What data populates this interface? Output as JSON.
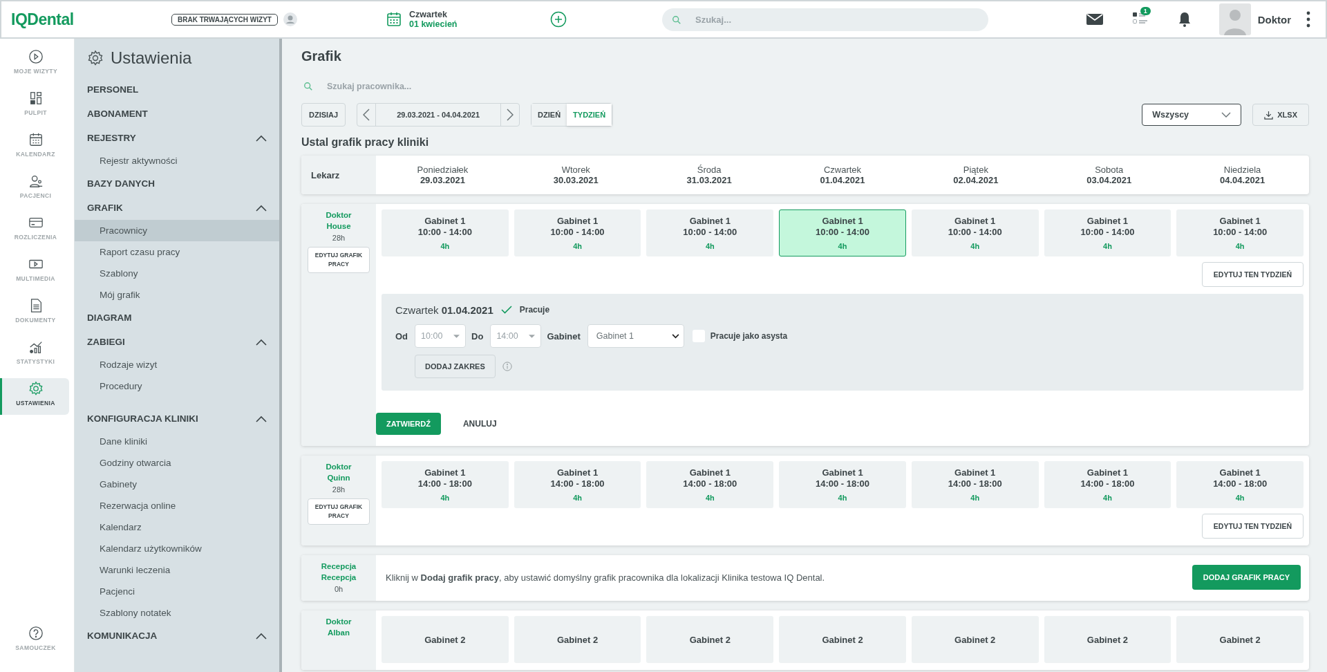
{
  "topbar": {
    "logo": "IQDental",
    "visit_status": "BRAK TRWAJĄCYCH WIZYT",
    "weekday": "Czwartek",
    "date": "01 kwiecień",
    "search": {
      "placeholder": "Szukaj..."
    },
    "tasks_badge": "1",
    "user": "Doktor"
  },
  "nav": {
    "items": [
      {
        "label": "MOJE WIZYTY",
        "selected": false
      },
      {
        "label": "PULPIT",
        "selected": false
      },
      {
        "label": "KALENDARZ",
        "selected": false
      },
      {
        "label": "PACJENCI",
        "selected": false
      },
      {
        "label": "ROZLICZENIA",
        "selected": false
      },
      {
        "label": "MULTIMEDIA",
        "selected": false
      },
      {
        "label": "DOKUMENTY",
        "selected": false
      },
      {
        "label": "STATYSTYKI",
        "selected": false
      },
      {
        "label": "USTAWIENIA",
        "selected": true
      }
    ],
    "help": "SAMOUCZEK"
  },
  "settings": {
    "title": "Ustawienia",
    "sections": [
      {
        "label": "PERSONEL"
      },
      {
        "label": "ABONAMENT"
      },
      {
        "label": "REJESTRY",
        "expanded": true,
        "children": [
          {
            "label": "Rejestr aktywności",
            "selected": false
          }
        ]
      },
      {
        "label": "BAZY DANYCH"
      },
      {
        "label": "GRAFIK",
        "expanded": true,
        "children": [
          {
            "label": "Pracownicy",
            "selected": true
          },
          {
            "label": "Raport czasu pracy",
            "selected": false
          },
          {
            "label": "Szablony",
            "selected": false
          },
          {
            "label": "Mój grafik",
            "selected": false
          }
        ]
      },
      {
        "label": "DIAGRAM"
      },
      {
        "label": "ZABIEGI",
        "expanded": true,
        "children": [
          {
            "label": "Rodzaje wizyt",
            "selected": false
          },
          {
            "label": "Procedury",
            "selected": false
          }
        ]
      },
      {
        "label": "KONFIGURACJA KLINIKI",
        "expanded": true,
        "children": [
          {
            "label": "Dane kliniki",
            "selected": false
          },
          {
            "label": "Godziny otwarcia",
            "selected": false
          },
          {
            "label": "Gabinety",
            "selected": false
          },
          {
            "label": "Rezerwacja online",
            "selected": false
          },
          {
            "label": "Kalendarz",
            "selected": false
          },
          {
            "label": "Kalendarz użytkowników",
            "selected": false
          },
          {
            "label": "Warunki leczenia",
            "selected": false
          },
          {
            "label": "Pacjenci",
            "selected": false
          },
          {
            "label": "Szablony notatek",
            "selected": false
          }
        ]
      },
      {
        "label": "KOMUNIKACJA",
        "expanded": true
      }
    ]
  },
  "page": {
    "title": "Grafik",
    "employee_search": {
      "placeholder": "Szukaj pracownika..."
    },
    "today_button": "DZISIAJ",
    "range": "29.03.2021 - 04.04.2021",
    "view_tabs": [
      {
        "label": "DZIEŃ",
        "selected": false
      },
      {
        "label": "TYDZIEŃ",
        "selected": true
      }
    ],
    "filter": "Wszyscy",
    "export_button": "XLSX",
    "section_title": "Ustal grafik pracy kliniki"
  },
  "header": {
    "label": "Lekarz",
    "days": [
      {
        "weekday": "Poniedziałek",
        "date": "29.03.2021"
      },
      {
        "weekday": "Wtorek",
        "date": "30.03.2021"
      },
      {
        "weekday": "Środa",
        "date": "31.03.2021"
      },
      {
        "weekday": "Czwartek",
        "date": "01.04.2021"
      },
      {
        "weekday": "Piątek",
        "date": "02.04.2021"
      },
      {
        "weekday": "Sobota",
        "date": "03.04.2021"
      },
      {
        "weekday": "Niedziela",
        "date": "04.04.2021"
      }
    ]
  },
  "employees": [
    {
      "kind": "schedule",
      "role": "Doktor",
      "name": "House",
      "hours": "28h",
      "edit_button": "EDYTUJ GRAFIK PRACY",
      "week_button": "EDYTUJ TEN TYDZIEŃ",
      "shifts": [
        {
          "room": "Gabinet 1",
          "time": "10:00 - 14:00",
          "duration": "4h",
          "selected": false
        },
        {
          "room": "Gabinet 1",
          "time": "10:00 - 14:00",
          "duration": "4h",
          "selected": false
        },
        {
          "room": "Gabinet 1",
          "time": "10:00 - 14:00",
          "duration": "4h",
          "selected": false
        },
        {
          "room": "Gabinet 1",
          "time": "10:00 - 14:00",
          "duration": "4h",
          "selected": true
        },
        {
          "room": "Gabinet 1",
          "time": "10:00 - 14:00",
          "duration": "4h",
          "selected": false
        },
        {
          "room": "Gabinet 1",
          "time": "10:00 - 14:00",
          "duration": "4h",
          "selected": false
        },
        {
          "room": "Gabinet 1",
          "time": "10:00 - 14:00",
          "duration": "4h",
          "selected": false
        }
      ],
      "editor": {
        "weekday": "Czwartek",
        "date": "01.04.2021",
        "works": {
          "label": "Pracuje",
          "checked": true
        },
        "from_label": "Od",
        "from": "10:00",
        "to_label": "Do",
        "to": "14:00",
        "room_label": "Gabinet",
        "room": "Gabinet 1",
        "assistant": {
          "label": "Pracuje jako asysta",
          "checked": false
        },
        "add_range": "DODAJ ZAKRES",
        "confirm": "ZATWIERDŹ",
        "cancel": "ANULUJ"
      }
    },
    {
      "kind": "schedule",
      "role": "Doktor",
      "name": "Quinn",
      "hours": "28h",
      "edit_button": "EDYTUJ GRAFIK PRACY",
      "week_button": "EDYTUJ TEN TYDZIEŃ",
      "shifts": [
        {
          "room": "Gabinet 1",
          "time": "14:00 - 18:00",
          "duration": "4h",
          "selected": false
        },
        {
          "room": "Gabinet 1",
          "time": "14:00 - 18:00",
          "duration": "4h",
          "selected": false
        },
        {
          "room": "Gabinet 1",
          "time": "14:00 - 18:00",
          "duration": "4h",
          "selected": false
        },
        {
          "room": "Gabinet 1",
          "time": "14:00 - 18:00",
          "duration": "4h",
          "selected": false
        },
        {
          "room": "Gabinet 1",
          "time": "14:00 - 18:00",
          "duration": "4h",
          "selected": false
        },
        {
          "room": "Gabinet 1",
          "time": "14:00 - 18:00",
          "duration": "4h",
          "selected": false
        },
        {
          "room": "Gabinet 1",
          "time": "14:00 - 18:00",
          "duration": "4h",
          "selected": false
        }
      ]
    },
    {
      "kind": "empty",
      "role": "Recepcja",
      "name": "Recepcja",
      "hours": "0h",
      "message": "Kliknij w **Dodaj grafik pracy**, aby ustawić domyślny grafik pracownika dla lokalizacji Klinika testowa IQ Dental.",
      "add_button": "DODAJ GRAFIK PRACY"
    },
    {
      "kind": "schedule",
      "role": "Doktor",
      "name": "Alban",
      "shifts": [
        {
          "room": "Gabinet 2",
          "selected": false
        },
        {
          "room": "Gabinet 2",
          "selected": false
        },
        {
          "room": "Gabinet 2",
          "selected": false
        },
        {
          "room": "Gabinet 2",
          "selected": false
        },
        {
          "room": "Gabinet 2",
          "selected": false
        },
        {
          "room": "Gabinet 2",
          "selected": false
        },
        {
          "room": "Gabinet 2",
          "selected": false
        }
      ]
    }
  ]
}
